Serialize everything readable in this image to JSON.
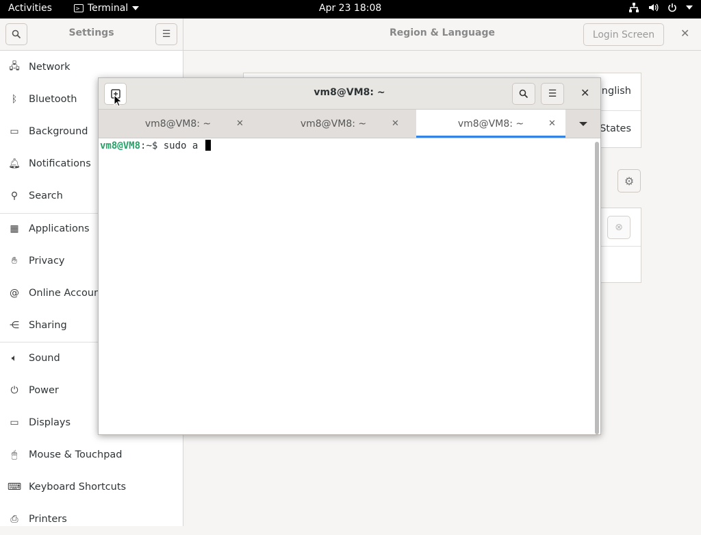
{
  "topbar": {
    "activities": "Activities",
    "app_name": "Terminal",
    "clock": "Apr 23  18:08"
  },
  "settings": {
    "title": "Settings",
    "panel_title": "Region & Language",
    "login_screen": "Login Screen",
    "sidebar": [
      {
        "label": "Network",
        "icon": "network-icon"
      },
      {
        "label": "Bluetooth",
        "icon": "bluetooth-icon"
      },
      {
        "label": "Background",
        "icon": "background-icon"
      },
      {
        "label": "Notifications",
        "icon": "bell-icon"
      },
      {
        "label": "Search",
        "icon": "search-icon"
      },
      {
        "label": "Applications",
        "icon": "grid-icon"
      },
      {
        "label": "Privacy",
        "icon": "hand-icon"
      },
      {
        "label": "Online Accounts",
        "icon": "at-icon"
      },
      {
        "label": "Sharing",
        "icon": "share-icon"
      },
      {
        "label": "Sound",
        "icon": "speaker-icon"
      },
      {
        "label": "Power",
        "icon": "power-icon"
      },
      {
        "label": "Displays",
        "icon": "display-icon"
      },
      {
        "label": "Mouse & Touchpad",
        "icon": "mouse-icon"
      },
      {
        "label": "Keyboard Shortcuts",
        "icon": "keyboard-icon"
      },
      {
        "label": "Printers",
        "icon": "printer-icon"
      }
    ],
    "language_value": "English",
    "formats_value": "States"
  },
  "terminal": {
    "title": "vm8@VM8: ~",
    "tabs": [
      "vm8@VM8: ~",
      "vm8@VM8: ~",
      "vm8@VM8: ~"
    ],
    "prompt_user": "vm8@VM8",
    "prompt_path": ":~$ ",
    "command": "sudo a"
  },
  "colors": {
    "accent": "#3584e4",
    "prompt_green": "#26a269"
  }
}
